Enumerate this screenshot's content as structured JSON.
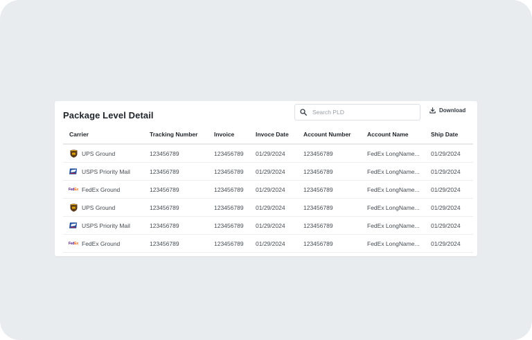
{
  "panel": {
    "title": "Package Level Detail",
    "search_placeholder": "Search PLD",
    "download_label": "Download"
  },
  "table": {
    "headers": [
      "Carrier",
      "Tracking Number",
      "Invoice",
      "Invoce Date",
      "Account Number",
      "Account Name",
      "Ship Date"
    ],
    "rows": [
      {
        "carrier": "UPS Ground",
        "logo": "ups-icon",
        "tracking": "123456789",
        "invoice": "123456789",
        "invoice_date": "01/29/2024",
        "account_number": "123456789",
        "account_name": "FedEx LongName...",
        "ship_date": "01/29/2024"
      },
      {
        "carrier": "USPS Priority Mail",
        "logo": "usps-icon",
        "tracking": "123456789",
        "invoice": "123456789",
        "invoice_date": "01/29/2024",
        "account_number": "123456789",
        "account_name": "FedEx LongName...",
        "ship_date": "01/29/2024"
      },
      {
        "carrier": "FedEx Ground",
        "logo": "fedex-icon",
        "tracking": "123456789",
        "invoice": "123456789",
        "invoice_date": "01/29/2024",
        "account_number": "123456789",
        "account_name": "FedEx LongName...",
        "ship_date": "01/29/2024"
      },
      {
        "carrier": "UPS Ground",
        "logo": "ups-icon",
        "tracking": "123456789",
        "invoice": "123456789",
        "invoice_date": "01/29/2024",
        "account_number": "123456789",
        "account_name": "FedEx LongName...",
        "ship_date": "01/29/2024"
      },
      {
        "carrier": "USPS Priority Mail",
        "logo": "usps-icon",
        "tracking": "123456789",
        "invoice": "123456789",
        "invoice_date": "01/29/2024",
        "account_number": "123456789",
        "account_name": "FedEx LongName...",
        "ship_date": "01/29/2024"
      },
      {
        "carrier": "FedEx Ground",
        "logo": "fedex-icon",
        "tracking": "123456789",
        "invoice": "123456789",
        "invoice_date": "01/29/2024",
        "account_number": "123456789",
        "account_name": "FedEx LongName...",
        "ship_date": "01/29/2024"
      }
    ]
  },
  "colors": {
    "ups_brown": "#5b3a1a",
    "ups_gold": "#f2b400",
    "usps_blue": "#1f4e9c",
    "fedex_purple": "#4d148c",
    "fedex_orange": "#ff6600"
  }
}
